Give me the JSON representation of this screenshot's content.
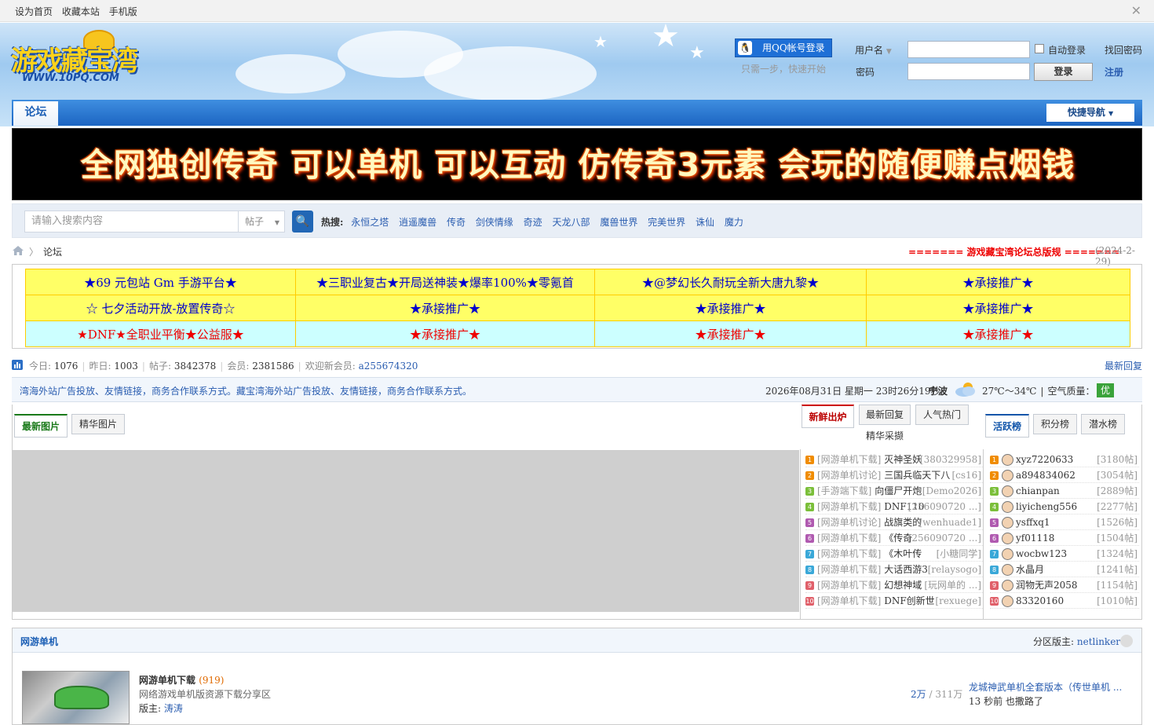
{
  "topbar": {
    "links": [
      "设为首页",
      "收藏本站",
      "手机版"
    ]
  },
  "logo": {
    "text": "游戏藏宝湾",
    "url_text": "WWW.10PQ.COM"
  },
  "login": {
    "qq_button": "用QQ帐号登录",
    "qq_sub": "只需一步，快速开始",
    "username_label": "用户名",
    "password_label": "密码",
    "auto_login": "自动登录",
    "find_password": "找回密码",
    "login_button": "登录",
    "register": "注册"
  },
  "nav": {
    "tab": "论坛",
    "quick_nav": "快捷导航"
  },
  "banner": {
    "text": "全网独创传奇 可以单机 可以互动 仿传奇3元素 会玩的随便赚点烟钱"
  },
  "search": {
    "placeholder": "请输入搜索内容",
    "type": "帖子",
    "hot_label": "热搜:",
    "hot": [
      "永恒之塔",
      "逍遥魔兽",
      "传奇",
      "剑侠情缘",
      "奇迹",
      "天龙八部",
      "魔兽世界",
      "完美世界",
      "诛仙",
      "魔力"
    ]
  },
  "breadcrumb": {
    "current": "论坛",
    "rule": "======= 游戏藏宝湾论坛总版规 =======",
    "rule_date": "(2024-2-29)"
  },
  "ads": [
    [
      "★69 元包站 Gm 手游平台★",
      "★三职业复古★开局送神装★爆率100%★零氪首",
      "★@梦幻长久耐玩全新大唐九黎★",
      "★承接推广★"
    ],
    [
      "☆ 七夕活动开放-放置传奇☆",
      "★承接推广★",
      "★承接推广★",
      "★承接推广★"
    ],
    [
      "★DNF★全职业平衡★公益服★",
      "★承接推广★",
      "★承接推广★",
      "★承接推广★"
    ]
  ],
  "stats": {
    "today_label": "今日:",
    "today": "1076",
    "yesterday_label": "昨日:",
    "yesterday": "1003",
    "posts_label": "帖子:",
    "posts": "3842378",
    "members_label": "会员:",
    "members": "2381586",
    "welcome_label": "欢迎新会员:",
    "new_member": "a255674320",
    "latest_reply": "最新回复"
  },
  "notice": {
    "marquee": "湾海外站广告投放、友情链接，商务合作联系方式。藏宝湾海外站广告投放、友情链接，商务合作联系方式。",
    "datetime": "2026年08月31日 星期一 23时26分19秒",
    "city": "宁波",
    "temp": "27℃～34℃",
    "aq_label": "空气质量：",
    "aq": "优"
  },
  "portal": {
    "pic_tabs": [
      "最新图片",
      "精华图片"
    ],
    "thread_tabs": [
      "新鲜出炉",
      "最新回复",
      "人气热门",
      "精华采撷"
    ],
    "user_tabs": [
      "活跃榜",
      "积分榜",
      "潜水榜"
    ],
    "threads": [
      {
        "n": "1",
        "cat": "[网游单机下载]",
        "title": "灭神圣妖",
        "author": "[380329958]"
      },
      {
        "n": "2",
        "cat": "[网游单机讨论]",
        "title": "三国兵临天下八",
        "author": "[cs16]"
      },
      {
        "n": "3",
        "cat": "[手游端下载]",
        "title": "向僵尸开炮",
        "author": "[Demo2026]"
      },
      {
        "n": "4",
        "cat": "[网游单机下载]",
        "title": "DNF110",
        "author": "[256090720 ...]"
      },
      {
        "n": "5",
        "cat": "[网游单机讨论]",
        "title": "战旗类的",
        "author": "[wenhuade1]"
      },
      {
        "n": "6",
        "cat": "[网游单机下载]",
        "title": "《传奇",
        "author": "[256090720 ...]"
      },
      {
        "n": "7",
        "cat": "[网游单机下载]",
        "title": "《木叶传",
        "author": "[小糖同学]"
      },
      {
        "n": "8",
        "cat": "[网游单机下载]",
        "title": "大话西游3",
        "author": "[relaysogo]"
      },
      {
        "n": "9",
        "cat": "[网游单机下载]",
        "title": "幻想神域",
        "author": "[玩网单的 ...]"
      },
      {
        "n": "10",
        "cat": "[网游单机下载]",
        "title": "DNF创新世",
        "author": "[rexuege]"
      }
    ],
    "users": [
      {
        "n": "1",
        "name": "xyz7220633",
        "count": "[3180帖]"
      },
      {
        "n": "2",
        "name": "a894834062",
        "count": "[3054帖]"
      },
      {
        "n": "3",
        "name": "chianpan",
        "count": "[2889帖]"
      },
      {
        "n": "4",
        "name": "liyicheng556",
        "count": "[2277帖]"
      },
      {
        "n": "5",
        "name": "ysffxq1",
        "count": "[1526帖]"
      },
      {
        "n": "6",
        "name": "yf01118",
        "count": "[1504帖]"
      },
      {
        "n": "7",
        "name": "wocbw123",
        "count": "[1324帖]"
      },
      {
        "n": "8",
        "name": "水晶月",
        "count": "[1241帖]"
      },
      {
        "n": "9",
        "name": "润物无声2058",
        "count": "[1154帖]"
      },
      {
        "n": "10",
        "name": "83320160",
        "count": "[1010帖]"
      }
    ]
  },
  "forum": {
    "section": "网游单机",
    "mod_label": "分区版主:",
    "mod": "netlinker",
    "board_name": "网游单机下载",
    "board_today": "(919)",
    "board_desc": "网络游戏单机版资源下载分享区",
    "board_mod_label": "版主:",
    "board_mod": "涛涛",
    "threads_count": "2万",
    "posts_count": "/ 311万",
    "last_title": "龙城神武单机全套版本（传世单机 ...",
    "last_time": "13 秒前 也撒路了"
  },
  "colors": {
    "nav_blue": "#1c65c2",
    "link": "#2a5db0",
    "hot_red": "#e00000",
    "ad_yellow": "#ffff66",
    "ad_cyan": "#ccffff"
  }
}
